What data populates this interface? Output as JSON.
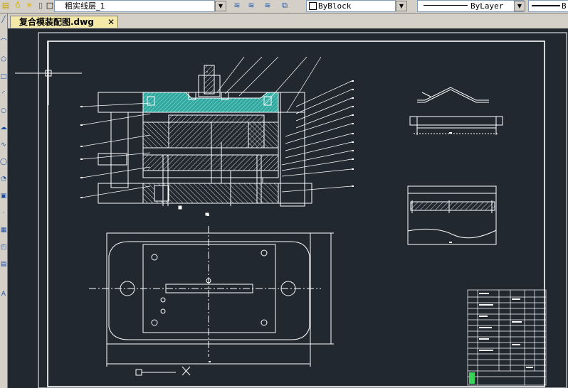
{
  "toolbar": {
    "layer_value": "粗实线层_1",
    "color_value": "ByBlock",
    "linetype_value": "ByLayer",
    "linetype_prefix": "B",
    "icons": [
      "layer-manager-icon",
      "bulb-icon",
      "sun-icon",
      "lock-icon",
      "color-square-icon",
      "layer-prev-icon",
      "layer-state-icon",
      "layer-walk-icon",
      "layer-match-icon"
    ]
  },
  "document_tab": {
    "title": "复合模装配图.dwg",
    "close_glyph": "✕"
  },
  "left_tools": [
    "line-icon",
    "polyline-icon",
    "polygon-icon",
    "rectangle-icon",
    "arc-icon",
    "circle-icon",
    "cloud-icon",
    "spline-icon",
    "ellipse-icon",
    "insert-icon",
    "block-icon",
    "point-icon",
    "hatch-icon",
    "region-icon",
    "table-icon",
    "text-icon"
  ],
  "colors": {
    "canvas": "#212830",
    "lines": "#ffffff",
    "hatch_cyan": "#2fa8a0",
    "tb_green": "#3bd25a"
  }
}
